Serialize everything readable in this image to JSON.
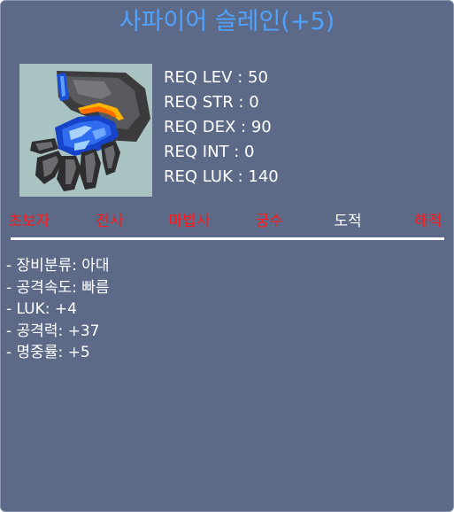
{
  "item": {
    "name": "사파이어 슬레인(+5)",
    "icon": "sapphire-glove-icon",
    "colors": {
      "background": "#5c6a88",
      "title": "#4fa2ff",
      "job_disabled": "#ff1a1a",
      "job_enabled": "#ffffff"
    }
  },
  "requirements": [
    "REQ LEV : 50",
    "REQ STR : 0",
    "REQ DEX : 90",
    "REQ INT : 0",
    "REQ LUK : 140"
  ],
  "jobs": [
    {
      "label": "초보자",
      "enabled": false
    },
    {
      "label": "전사",
      "enabled": false
    },
    {
      "label": "마법사",
      "enabled": false
    },
    {
      "label": "궁수",
      "enabled": false
    },
    {
      "label": "도적",
      "enabled": true
    },
    {
      "label": "해적",
      "enabled": false
    }
  ],
  "stats": [
    "- 장비분류: 아대",
    "- 공격속도: 빠름",
    "- LUK: +4",
    "- 공격력: +37",
    "- 명중률: +5"
  ]
}
